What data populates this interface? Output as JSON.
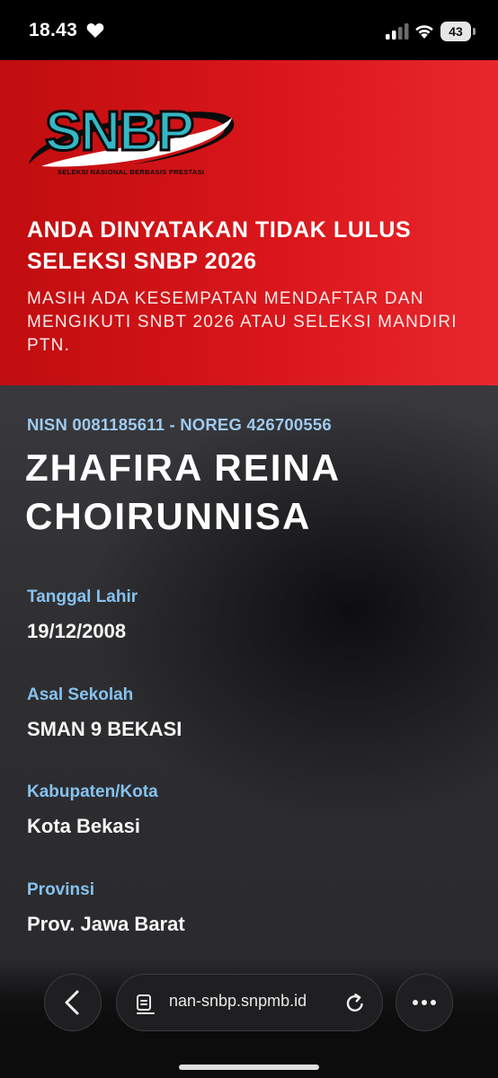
{
  "status_bar": {
    "time": "18.43",
    "battery_level": "43",
    "icons": [
      "heart-icon",
      "signal-icon",
      "wifi-icon",
      "battery-icon"
    ]
  },
  "banner": {
    "logo_text": "SNBP",
    "logo_caption": "SELEKSI NASIONAL BERBASIS PRESTASI",
    "title": "ANDA DINYATAKAN TIDAK LULUS SELEKSI SNBP 2026",
    "subtitle": "MASIH ADA KESEMPATAN MENDAFTAR DAN MENGIKUTI SNBT 2026 ATAU SELEKSI MANDIRI PTN.",
    "colors": {
      "red_start": "#c00d0f",
      "red_end": "#e8272d",
      "logo_teal": "#35b6c4"
    }
  },
  "student": {
    "id_line": "NISN 0081185611 - NOREG 426700556",
    "name": "ZHAFIRA REINA CHOIRUNNISA",
    "fields": [
      {
        "label": "Tanggal Lahir",
        "value": "19/12/2008"
      },
      {
        "label": "Asal Sekolah",
        "value": "SMAN 9 BEKASI"
      },
      {
        "label": "Kabupaten/Kota",
        "value": "Kota Bekasi"
      },
      {
        "label": "Provinsi",
        "value": "Prov. Jawa Barat"
      }
    ],
    "colors": {
      "label": "#86c2ef",
      "value": "#f5f5f5"
    }
  },
  "browser": {
    "url": "nan-snbp.snpmb.id",
    "icons": [
      "back-arrow-icon",
      "page-icon",
      "reload-icon",
      "more-icon"
    ]
  }
}
